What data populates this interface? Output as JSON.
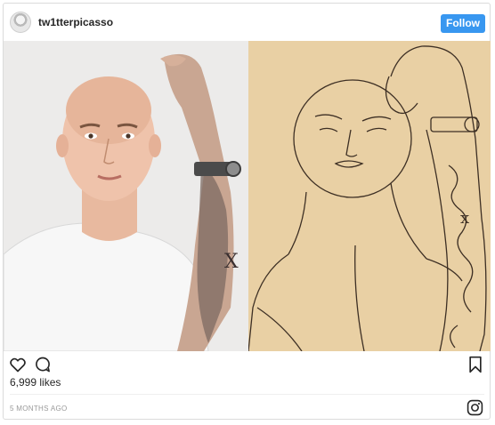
{
  "post": {
    "username": "tw1tterpicasso",
    "follow_label": "Follow",
    "likes": "6,999 likes",
    "timestamp": "5 MONTHS AGO"
  },
  "icons": {
    "like": "heart-outline-icon",
    "comment": "speech-bubble-icon",
    "save": "bookmark-icon",
    "brand": "instagram-glyph-icon"
  },
  "colors": {
    "follow_button": "#3897f0",
    "border": "#dbdbdb",
    "text": "#262626",
    "muted": "#999999",
    "sketch_paper": "#e8cfa3"
  }
}
